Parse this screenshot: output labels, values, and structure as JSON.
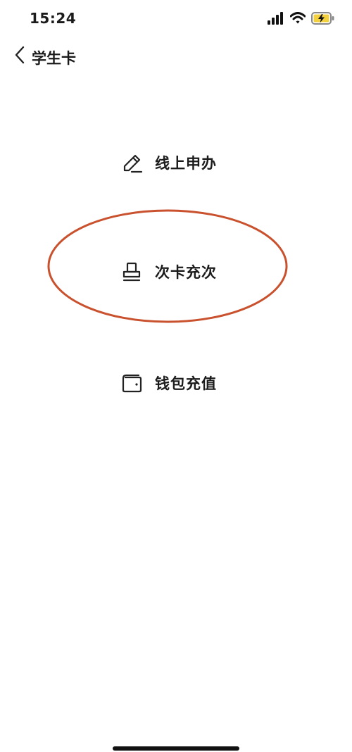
{
  "status_bar": {
    "time": "15:24",
    "icons": [
      "cellular-signal-icon",
      "wifi-icon",
      "battery-charging-icon"
    ],
    "battery_color": "#f3d03e"
  },
  "nav": {
    "back_icon": "chevron-left-icon",
    "title": "学生卡"
  },
  "menu": {
    "items": [
      {
        "icon": "pencil-icon",
        "label": "线上申办"
      },
      {
        "icon": "stamp-icon",
        "label": "次卡充次"
      },
      {
        "icon": "wallet-icon",
        "label": "钱包充值"
      }
    ]
  },
  "annotation": {
    "highlighted_item": "次卡充次",
    "ellipse_color": "#c9512d"
  }
}
